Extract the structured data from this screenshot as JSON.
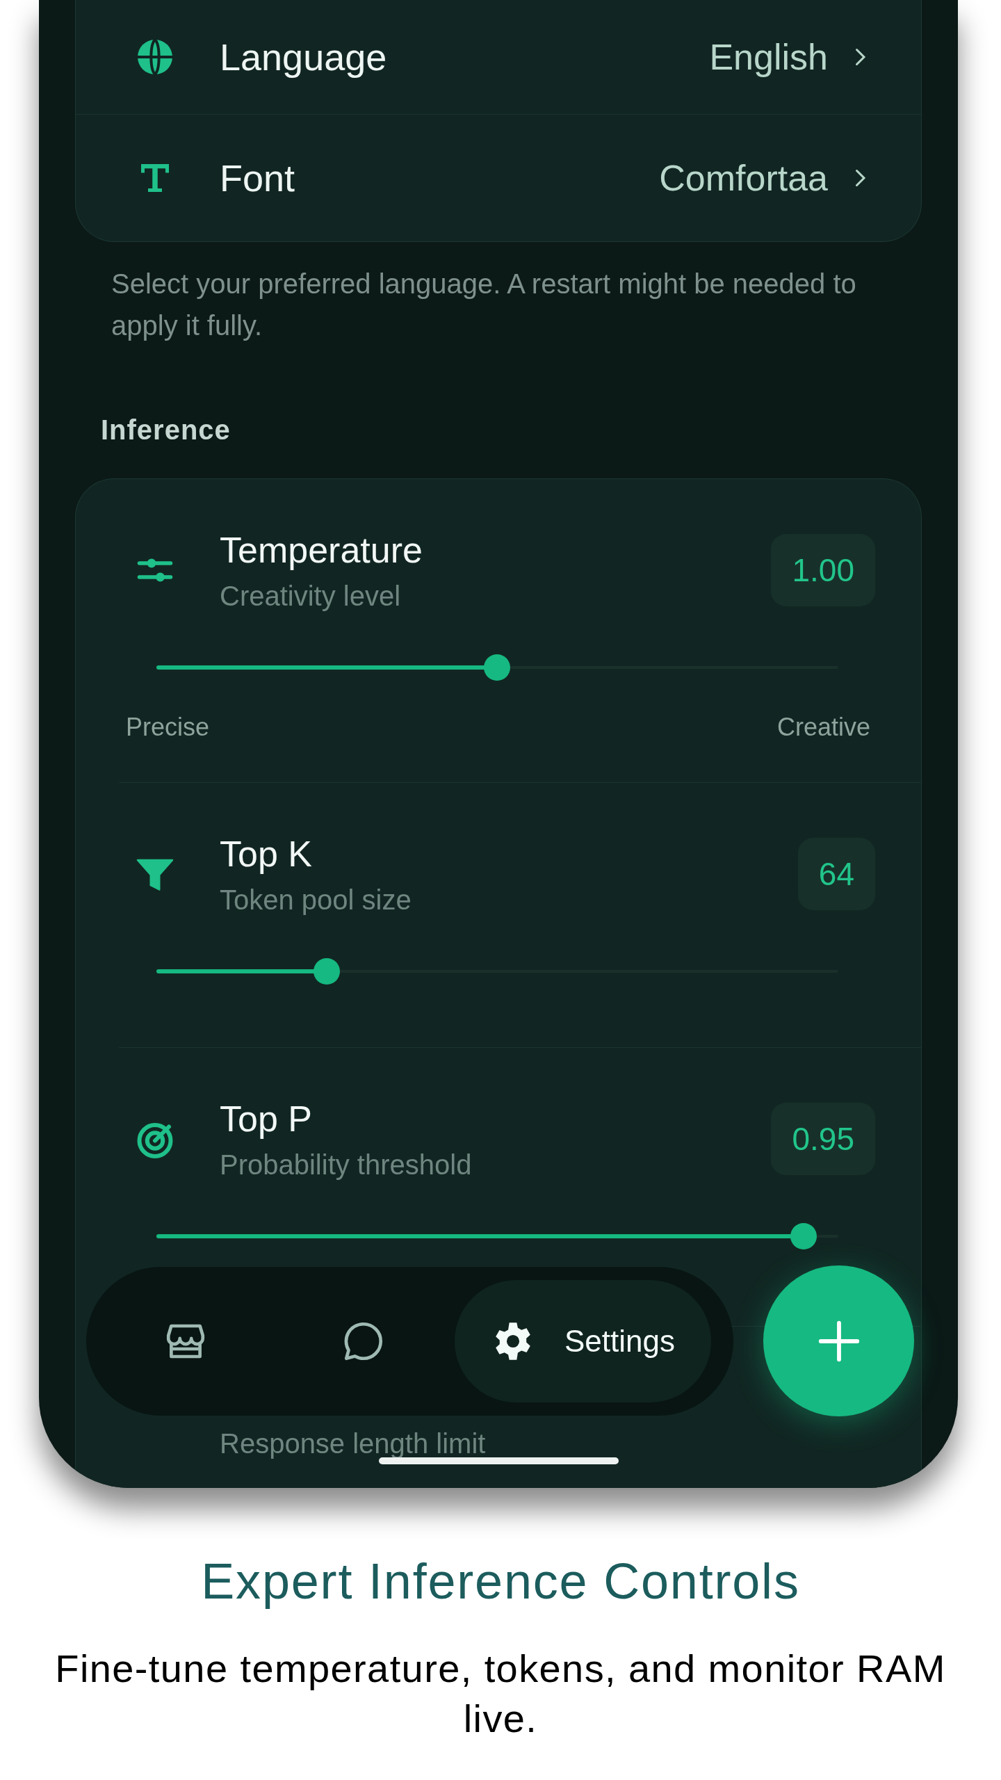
{
  "general": {
    "rows": [
      {
        "kind": "globe",
        "label": "Language",
        "value": "English"
      },
      {
        "kind": "font",
        "label": "Font",
        "value": "Comfortaa"
      }
    ],
    "helper": "Select your preferred language. A restart might be needed to apply it fully."
  },
  "inference": {
    "heading": "Inference",
    "items": [
      {
        "kind": "sliders",
        "title": "Temperature",
        "subtitle": "Creativity level",
        "value": "1.00",
        "level": 0.5,
        "min_label": "Precise",
        "max_label": "Creative"
      },
      {
        "kind": "funnel",
        "title": "Top K",
        "subtitle": "Token pool size",
        "value": "64",
        "level": 0.25
      },
      {
        "kind": "target",
        "title": "Top P",
        "subtitle": "Probability threshold",
        "value": "0.95",
        "level": 0.95
      },
      {
        "subtitle": "Response length limit"
      }
    ]
  },
  "nav": [
    {
      "kind": "store",
      "selected": false
    },
    {
      "kind": "chat",
      "selected": false
    },
    {
      "kind": "gear",
      "label": "Settings",
      "selected": true
    }
  ],
  "caption": {
    "title": "Expert Inference Controls",
    "text": "Fine-tune temperature, tokens, and monitor RAM live."
  }
}
